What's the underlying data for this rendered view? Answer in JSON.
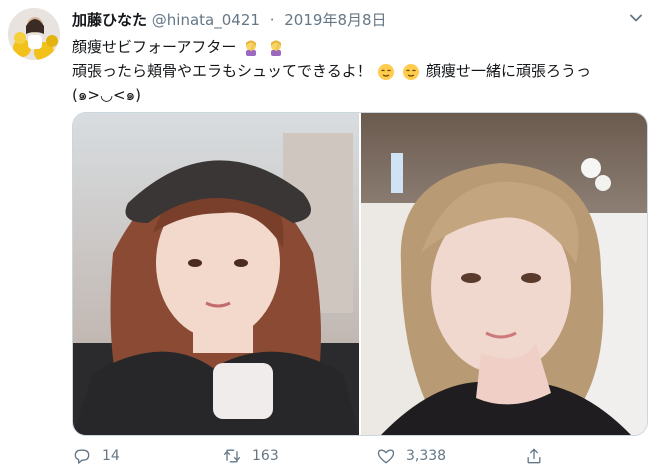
{
  "tweet": {
    "display_name": "加藤ひなた",
    "handle": "@hinata_0421",
    "separator": "·",
    "date": "2019年8月8日",
    "text_line1": "顔痩せビフォーアフター",
    "text_line2_a": "頑張ったら頬骨やエラもシュッてできるよ！",
    "text_line2_b": "顔痩せ一緒に頑張ろうっ",
    "text_line3": "(๑>◡<๑)"
  },
  "actions": {
    "reply_count": "14",
    "retweet_count": "163",
    "like_count": "3,338"
  },
  "icons": {
    "menu": "chevron-down-icon",
    "reply": "reply-icon",
    "retweet": "retweet-icon",
    "like": "heart-icon",
    "share": "share-icon"
  },
  "colors": {
    "text": "#14171a",
    "secondary": "#657786",
    "border": "#ccd6dd"
  }
}
